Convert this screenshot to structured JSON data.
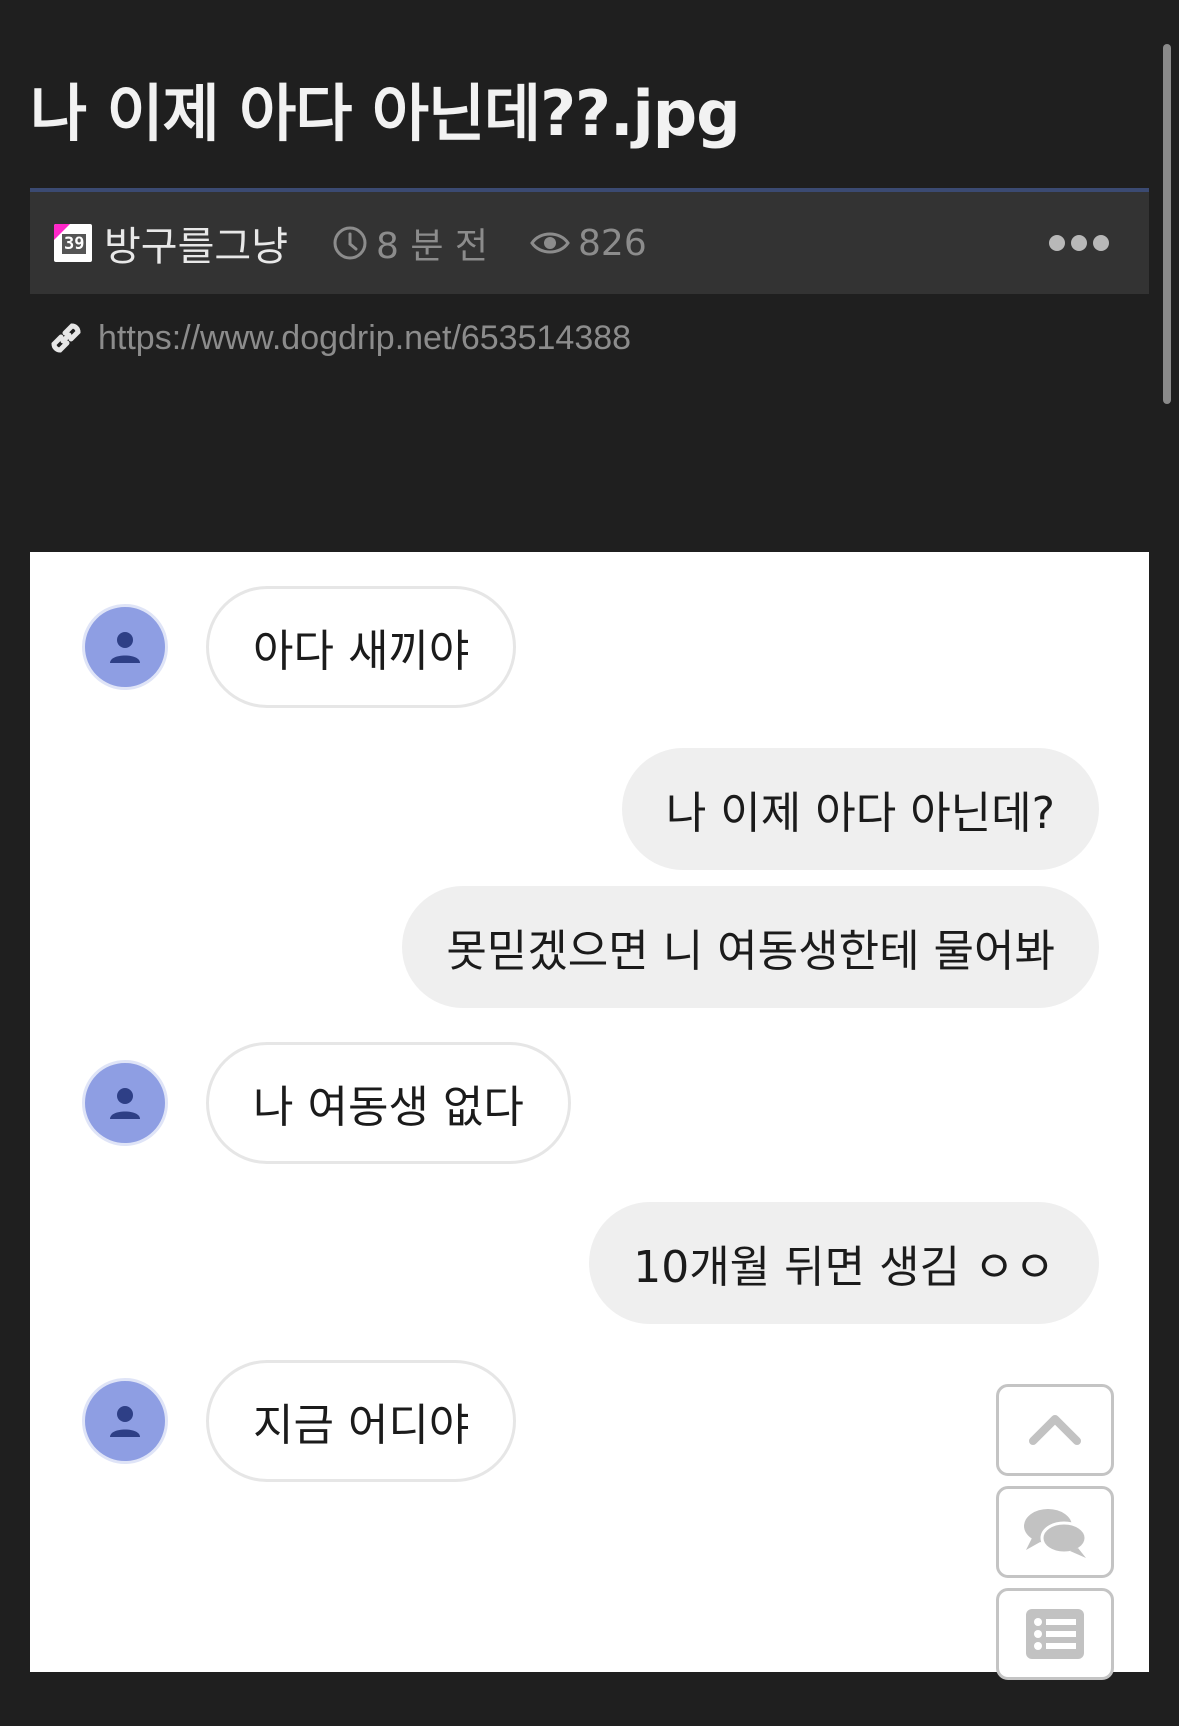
{
  "post": {
    "title": "나 이제 아다 아닌데??.jpg",
    "author_badge": "39",
    "author": "방구를그냥",
    "time": "8 분 전",
    "views": "826",
    "url": "https://www.dogdrip.net/653514388"
  },
  "chat": {
    "messages": [
      {
        "side": "received",
        "text": "아다 새끼야"
      },
      {
        "side": "sent",
        "text": "나 이제 아다 아닌데?"
      },
      {
        "side": "sent",
        "text": "못믿겠으면 니 여동생한테 물어봐"
      },
      {
        "side": "received",
        "text": "나 여동생 없다"
      },
      {
        "side": "sent",
        "text": "10개월 뒤면 생김 ㅇㅇ"
      },
      {
        "side": "received",
        "text": "지금 어디야"
      }
    ]
  },
  "icons": {
    "clock": "clock-icon",
    "views": "eye-icon",
    "link": "link-icon",
    "more": "more-dots-icon",
    "avatar": "person-icon",
    "scroll_top": "chevron-up-icon",
    "comments": "comments-icon",
    "list": "list-icon"
  },
  "colors": {
    "background": "#1f1f1f",
    "meta_bar": "#333333",
    "meta_accent": "#3b4a72",
    "avatar": "#8e9ee3",
    "badge_pink": "#ff27c9"
  }
}
